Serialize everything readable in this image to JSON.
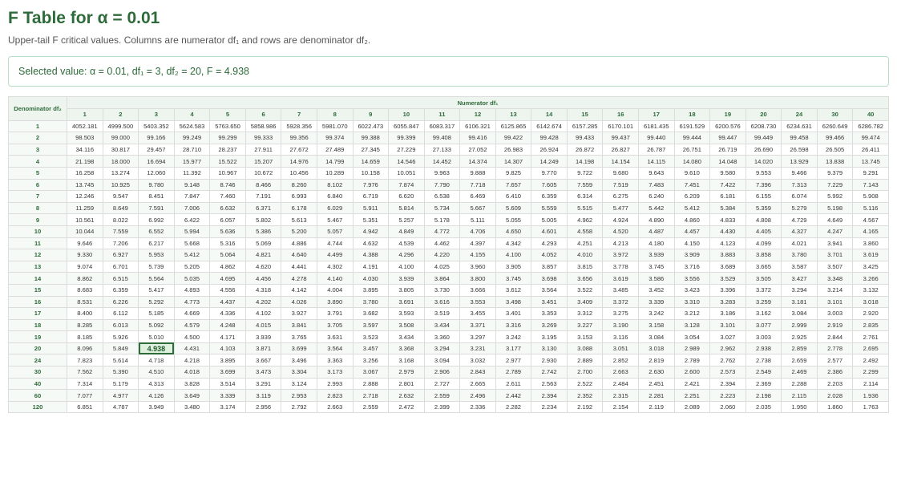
{
  "title": "F Table for α = 0.01",
  "subtitle": "Upper-tail F critical values. Columns are numerator df₁ and rows are denominator df₂.",
  "selected": "Selected value: α = 0.01, df₁ = 3, df₂ = 20, F = 4.938",
  "selected_cell": {
    "df1": "3",
    "df2": "20"
  },
  "table": {
    "corner_label": "Denominator df₂",
    "column_group_label": "Numerator df₁",
    "columns": [
      "1",
      "2",
      "3",
      "4",
      "5",
      "6",
      "7",
      "8",
      "9",
      "10",
      "11",
      "12",
      "13",
      "14",
      "15",
      "16",
      "17",
      "18",
      "19",
      "20",
      "24",
      "30",
      "40"
    ],
    "rows": [
      {
        "df2": "1",
        "values": [
          "4052.181",
          "4999.500",
          "5403.352",
          "5624.583",
          "5763.650",
          "5858.986",
          "5928.356",
          "5981.070",
          "6022.473",
          "6055.847",
          "6083.317",
          "6106.321",
          "6125.865",
          "6142.674",
          "6157.285",
          "6170.101",
          "6181.435",
          "6191.529",
          "6200.576",
          "6208.730",
          "6234.631",
          "6260.649",
          "6286.782"
        ]
      },
      {
        "df2": "2",
        "values": [
          "98.503",
          "99.000",
          "99.166",
          "99.249",
          "99.299",
          "99.333",
          "99.356",
          "99.374",
          "99.388",
          "99.399",
          "99.408",
          "99.416",
          "99.422",
          "99.428",
          "99.433",
          "99.437",
          "99.440",
          "99.444",
          "99.447",
          "99.449",
          "99.458",
          "99.466",
          "99.474"
        ]
      },
      {
        "df2": "3",
        "values": [
          "34.116",
          "30.817",
          "29.457",
          "28.710",
          "28.237",
          "27.911",
          "27.672",
          "27.489",
          "27.345",
          "27.229",
          "27.133",
          "27.052",
          "26.983",
          "26.924",
          "26.872",
          "26.827",
          "26.787",
          "26.751",
          "26.719",
          "26.690",
          "26.598",
          "26.505",
          "26.411"
        ]
      },
      {
        "df2": "4",
        "values": [
          "21.198",
          "18.000",
          "16.694",
          "15.977",
          "15.522",
          "15.207",
          "14.976",
          "14.799",
          "14.659",
          "14.546",
          "14.452",
          "14.374",
          "14.307",
          "14.249",
          "14.198",
          "14.154",
          "14.115",
          "14.080",
          "14.048",
          "14.020",
          "13.929",
          "13.838",
          "13.745"
        ]
      },
      {
        "df2": "5",
        "values": [
          "16.258",
          "13.274",
          "12.060",
          "11.392",
          "10.967",
          "10.672",
          "10.456",
          "10.289",
          "10.158",
          "10.051",
          "9.963",
          "9.888",
          "9.825",
          "9.770",
          "9.722",
          "9.680",
          "9.643",
          "9.610",
          "9.580",
          "9.553",
          "9.466",
          "9.379",
          "9.291"
        ]
      },
      {
        "df2": "6",
        "values": [
          "13.745",
          "10.925",
          "9.780",
          "9.148",
          "8.746",
          "8.466",
          "8.260",
          "8.102",
          "7.976",
          "7.874",
          "7.790",
          "7.718",
          "7.657",
          "7.605",
          "7.559",
          "7.519",
          "7.483",
          "7.451",
          "7.422",
          "7.396",
          "7.313",
          "7.229",
          "7.143"
        ]
      },
      {
        "df2": "7",
        "values": [
          "12.246",
          "9.547",
          "8.451",
          "7.847",
          "7.460",
          "7.191",
          "6.993",
          "6.840",
          "6.719",
          "6.620",
          "6.538",
          "6.469",
          "6.410",
          "6.359",
          "6.314",
          "6.275",
          "6.240",
          "6.209",
          "6.181",
          "6.155",
          "6.074",
          "5.992",
          "5.908"
        ]
      },
      {
        "df2": "8",
        "values": [
          "11.259",
          "8.649",
          "7.591",
          "7.006",
          "6.632",
          "6.371",
          "6.178",
          "6.029",
          "5.911",
          "5.814",
          "5.734",
          "5.667",
          "5.609",
          "5.559",
          "5.515",
          "5.477",
          "5.442",
          "5.412",
          "5.384",
          "5.359",
          "5.279",
          "5.198",
          "5.116"
        ]
      },
      {
        "df2": "9",
        "values": [
          "10.561",
          "8.022",
          "6.992",
          "6.422",
          "6.057",
          "5.802",
          "5.613",
          "5.467",
          "5.351",
          "5.257",
          "5.178",
          "5.111",
          "5.055",
          "5.005",
          "4.962",
          "4.924",
          "4.890",
          "4.860",
          "4.833",
          "4.808",
          "4.729",
          "4.649",
          "4.567"
        ]
      },
      {
        "df2": "10",
        "values": [
          "10.044",
          "7.559",
          "6.552",
          "5.994",
          "5.636",
          "5.386",
          "5.200",
          "5.057",
          "4.942",
          "4.849",
          "4.772",
          "4.706",
          "4.650",
          "4.601",
          "4.558",
          "4.520",
          "4.487",
          "4.457",
          "4.430",
          "4.405",
          "4.327",
          "4.247",
          "4.165"
        ]
      },
      {
        "df2": "11",
        "values": [
          "9.646",
          "7.206",
          "6.217",
          "5.668",
          "5.316",
          "5.069",
          "4.886",
          "4.744",
          "4.632",
          "4.539",
          "4.462",
          "4.397",
          "4.342",
          "4.293",
          "4.251",
          "4.213",
          "4.180",
          "4.150",
          "4.123",
          "4.099",
          "4.021",
          "3.941",
          "3.860"
        ]
      },
      {
        "df2": "12",
        "values": [
          "9.330",
          "6.927",
          "5.953",
          "5.412",
          "5.064",
          "4.821",
          "4.640",
          "4.499",
          "4.388",
          "4.296",
          "4.220",
          "4.155",
          "4.100",
          "4.052",
          "4.010",
          "3.972",
          "3.939",
          "3.909",
          "3.883",
          "3.858",
          "3.780",
          "3.701",
          "3.619"
        ]
      },
      {
        "df2": "13",
        "values": [
          "9.074",
          "6.701",
          "5.739",
          "5.205",
          "4.862",
          "4.620",
          "4.441",
          "4.302",
          "4.191",
          "4.100",
          "4.025",
          "3.960",
          "3.905",
          "3.857",
          "3.815",
          "3.778",
          "3.745",
          "3.716",
          "3.689",
          "3.665",
          "3.587",
          "3.507",
          "3.425"
        ]
      },
      {
        "df2": "14",
        "values": [
          "8.862",
          "6.515",
          "5.564",
          "5.035",
          "4.695",
          "4.456",
          "4.278",
          "4.140",
          "4.030",
          "3.939",
          "3.864",
          "3.800",
          "3.745",
          "3.698",
          "3.656",
          "3.619",
          "3.586",
          "3.556",
          "3.529",
          "3.505",
          "3.427",
          "3.348",
          "3.266"
        ]
      },
      {
        "df2": "15",
        "values": [
          "8.683",
          "6.359",
          "5.417",
          "4.893",
          "4.556",
          "4.318",
          "4.142",
          "4.004",
          "3.895",
          "3.805",
          "3.730",
          "3.666",
          "3.612",
          "3.564",
          "3.522",
          "3.485",
          "3.452",
          "3.423",
          "3.396",
          "3.372",
          "3.294",
          "3.214",
          "3.132"
        ]
      },
      {
        "df2": "16",
        "values": [
          "8.531",
          "6.226",
          "5.292",
          "4.773",
          "4.437",
          "4.202",
          "4.026",
          "3.890",
          "3.780",
          "3.691",
          "3.616",
          "3.553",
          "3.498",
          "3.451",
          "3.409",
          "3.372",
          "3.339",
          "3.310",
          "3.283",
          "3.259",
          "3.181",
          "3.101",
          "3.018"
        ]
      },
      {
        "df2": "17",
        "values": [
          "8.400",
          "6.112",
          "5.185",
          "4.669",
          "4.336",
          "4.102",
          "3.927",
          "3.791",
          "3.682",
          "3.593",
          "3.519",
          "3.455",
          "3.401",
          "3.353",
          "3.312",
          "3.275",
          "3.242",
          "3.212",
          "3.186",
          "3.162",
          "3.084",
          "3.003",
          "2.920"
        ]
      },
      {
        "df2": "18",
        "values": [
          "8.285",
          "6.013",
          "5.092",
          "4.579",
          "4.248",
          "4.015",
          "3.841",
          "3.705",
          "3.597",
          "3.508",
          "3.434",
          "3.371",
          "3.316",
          "3.269",
          "3.227",
          "3.190",
          "3.158",
          "3.128",
          "3.101",
          "3.077",
          "2.999",
          "2.919",
          "2.835"
        ]
      },
      {
        "df2": "19",
        "values": [
          "8.185",
          "5.926",
          "5.010",
          "4.500",
          "4.171",
          "3.939",
          "3.765",
          "3.631",
          "3.523",
          "3.434",
          "3.360",
          "3.297",
          "3.242",
          "3.195",
          "3.153",
          "3.116",
          "3.084",
          "3.054",
          "3.027",
          "3.003",
          "2.925",
          "2.844",
          "2.761"
        ]
      },
      {
        "df2": "20",
        "values": [
          "8.096",
          "5.849",
          "4.938",
          "4.431",
          "4.103",
          "3.871",
          "3.699",
          "3.564",
          "3.457",
          "3.368",
          "3.294",
          "3.231",
          "3.177",
          "3.130",
          "3.088",
          "3.051",
          "3.018",
          "2.989",
          "2.962",
          "2.938",
          "2.859",
          "2.778",
          "2.695"
        ]
      },
      {
        "df2": "24",
        "values": [
          "7.823",
          "5.614",
          "4.718",
          "4.218",
          "3.895",
          "3.667",
          "3.496",
          "3.363",
          "3.256",
          "3.168",
          "3.094",
          "3.032",
          "2.977",
          "2.930",
          "2.889",
          "2.852",
          "2.819",
          "2.789",
          "2.762",
          "2.738",
          "2.659",
          "2.577",
          "2.492"
        ]
      },
      {
        "df2": "30",
        "values": [
          "7.562",
          "5.390",
          "4.510",
          "4.018",
          "3.699",
          "3.473",
          "3.304",
          "3.173",
          "3.067",
          "2.979",
          "2.906",
          "2.843",
          "2.789",
          "2.742",
          "2.700",
          "2.663",
          "2.630",
          "2.600",
          "2.573",
          "2.549",
          "2.469",
          "2.386",
          "2.299"
        ]
      },
      {
        "df2": "40",
        "values": [
          "7.314",
          "5.179",
          "4.313",
          "3.828",
          "3.514",
          "3.291",
          "3.124",
          "2.993",
          "2.888",
          "2.801",
          "2.727",
          "2.665",
          "2.611",
          "2.563",
          "2.522",
          "2.484",
          "2.451",
          "2.421",
          "2.394",
          "2.369",
          "2.288",
          "2.203",
          "2.114"
        ]
      },
      {
        "df2": "60",
        "values": [
          "7.077",
          "4.977",
          "4.126",
          "3.649",
          "3.339",
          "3.119",
          "2.953",
          "2.823",
          "2.718",
          "2.632",
          "2.559",
          "2.496",
          "2.442",
          "2.394",
          "2.352",
          "2.315",
          "2.281",
          "2.251",
          "2.223",
          "2.198",
          "2.115",
          "2.028",
          "1.936"
        ]
      },
      {
        "df2": "120",
        "values": [
          "6.851",
          "4.787",
          "3.949",
          "3.480",
          "3.174",
          "2.956",
          "2.792",
          "2.663",
          "2.559",
          "2.472",
          "2.399",
          "2.336",
          "2.282",
          "2.234",
          "2.192",
          "2.154",
          "2.119",
          "2.089",
          "2.060",
          "2.035",
          "1.950",
          "1.860",
          "1.763"
        ]
      }
    ]
  }
}
